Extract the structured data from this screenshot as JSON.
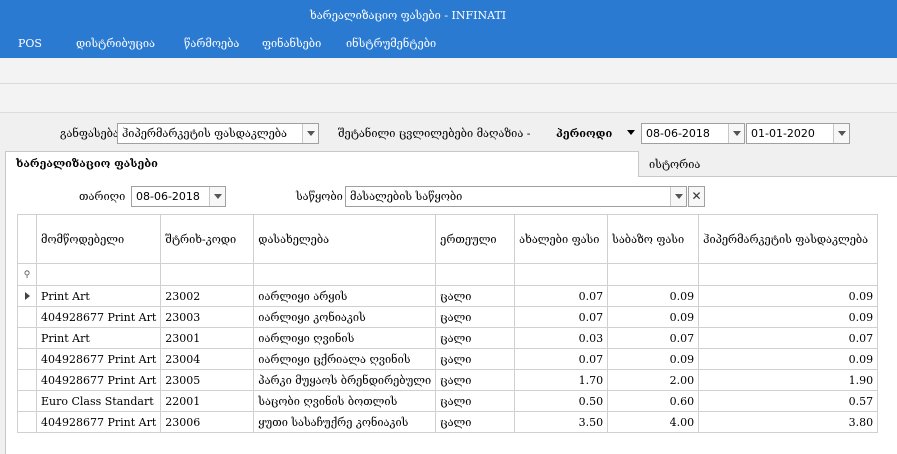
{
  "window": {
    "title": "ხარეალიზაციო ფასები - INFINATI"
  },
  "menu": [
    "POS",
    "დისტრიბუცია",
    "წარმოება",
    "ფინანსები",
    "ინსტრუმენტები"
  ],
  "filters": {
    "branch_label": "განფასება",
    "branch_value": "ჰიპერმარკეტის ფასდაკლება",
    "shop_changes_label": "შეტანილი ცვლილებები მაღაზია -",
    "period_label": "პერიოდი",
    "period_from": "08-06-2018",
    "period_to": "01-01-2020"
  },
  "tabs": {
    "active": "ხარეალიზაციო ფასები",
    "inactive": "ისტორია"
  },
  "panel": {
    "date_label": "თარიღი",
    "date_value": "08-06-2018",
    "warehouse_label": "საწყობი",
    "warehouse_value": "მასალების საწყობი"
  },
  "grid": {
    "columns": [
      "მომწოდებელი",
      "შტრიხ-კოდი",
      "დასახელება",
      "ერთეული",
      "ახალები ფასი",
      "საბაზო ფასი",
      "ჰიპერმარკეტის ფასდაკლება"
    ],
    "rows": [
      {
        "supplier": "Print Art",
        "barcode": "23002",
        "name": "იარლიყი არყის",
        "unit": "ცალი",
        "new_price": "0.07",
        "base_price": "0.09",
        "discount": "0.09"
      },
      {
        "supplier": "404928677   Print Art",
        "barcode": "23003",
        "name": "იარლიყი კონიაკის",
        "unit": "ცალი",
        "new_price": "0.07",
        "base_price": "0.09",
        "discount": "0.09"
      },
      {
        "supplier": "Print Art",
        "barcode": "23001",
        "name": "იარლიყი ღვინის",
        "unit": "ცალი",
        "new_price": "0.03",
        "base_price": "0.07",
        "discount": "0.07"
      },
      {
        "supplier": "404928677   Print Art",
        "barcode": "23004",
        "name": "იარლიყი ცქრიალა ღვინის",
        "unit": "ცალი",
        "new_price": "0.07",
        "base_price": "0.09",
        "discount": "0.09"
      },
      {
        "supplier": "404928677   Print Art",
        "barcode": "23005",
        "name": "პარკი მუყაოს ბრენდირებული",
        "unit": "ცალი",
        "new_price": "1.70",
        "base_price": "2.00",
        "discount": "1.90"
      },
      {
        "supplier": "Euro Class Standart",
        "barcode": "22001",
        "name": "საცობი ღვინის ბოთლის",
        "unit": "ცალი",
        "new_price": "0.50",
        "base_price": "0.60",
        "discount": "0.57"
      },
      {
        "supplier": "404928677   Print Art",
        "barcode": "23006",
        "name": "ყუთი სასაჩუქრე კონიაკის",
        "unit": "ცალი",
        "new_price": "3.50",
        "base_price": "4.00",
        "discount": "3.80"
      }
    ]
  }
}
